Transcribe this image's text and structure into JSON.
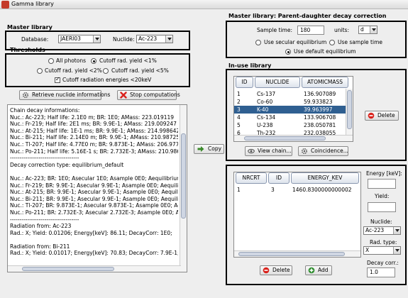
{
  "window": {
    "title": "Gamma library"
  },
  "master": {
    "title": "Master library",
    "database_label": "Database:",
    "database_value": "JAERI03",
    "nuclide_label": "Nuclide:",
    "nuclide_value": "Ac-223",
    "thresholds_title": "Thresholds",
    "radios": {
      "all_photons": "All photons",
      "cutoff1": "Cutoff rad. yield <1%",
      "cutoff2": "Cutoff rad. yield <2%",
      "cutoff5": "Cutoff rad. yield <5%"
    },
    "cutoff_checkbox": "Cutoff radiation energies <20keV",
    "retrieve_button": "Retrieve nuclide informations",
    "stop_button": "Stop computations",
    "copy_button": "Copy",
    "info_lines": [
      "Chain decay informations:",
      "Nuc.: Ac-223; Half life: 2.1E0 m; BR: 1E0; AMass: 223.019119",
      "Nuc.: Fr-219; Half life: 2E1 ms; BR: 9.9E-1; AMass: 219.009247",
      "Nuc.: At-215; Half life: 1E-1 ms; BR: 9.9E-1; AMass: 214.998642",
      "Nuc.: Bi-211; Half life: 2.14E0 m; BR: 9.9E-1; AMass: 210.987259",
      "Nuc.: Tl-207; Half life: 4.77E0 m; BR: 9.873E-1; AMass: 206.977402",
      "Nuc.: Po-211; Half life: 5.16E-1 s; BR: 2.732E-3; AMass: 210.986633",
      "------------------------------------",
      "Decay correction type: equilibrium_default",
      "",
      "Nuc.: Ac-223; BR: 1E0; Asecular 1E0; Asample 0E0; Aequilibrium 1E0; D",
      "Nuc.: Fr-219; BR: 9.9E-1; Asecular 9.9E-1; Asample 0E0; Aequilibrium 9.",
      "Nuc.: At-215; BR: 9.9E-1; Asecular 9.9E-1; Asample 0E0; Aequilibrium 9.",
      "Nuc.: Bi-211; BR: 9.9E-1; Asecular 9.9E-1; Asample 0E0; Aequilibrium 9.",
      "Nuc.: Tl-207; BR: 9.873E-1; Asecular 9.873E-1; Asample 0E0; Aequilibriu",
      "Nuc.: Po-211; BR: 2.732E-3; Asecular 2.732E-3; Asample 0E0; Aequilibriu",
      "------------------------------------",
      "Radiation from: Ac-223",
      "Rad.: X; Yield: 0.01206; Energy[keV]: 86.11; DecayCorr: 1E0;",
      "",
      "Radiation from: Bi-211",
      "Rad.: X; Yield: 0.01017; Energy[keV]: 70.83; DecayCorr: 7.9E-1;"
    ]
  },
  "decay": {
    "title": "Master library: Parent-daughter decay correction",
    "sample_time_label": "Sample time:",
    "sample_time_value": "180",
    "units_label": "units:",
    "units_value": "d",
    "use_secular": "Use secular equilibrium",
    "use_sample_time": "Use sample time",
    "use_default": "Use default equilibrium"
  },
  "inuse": {
    "title": "In-use library",
    "columns": [
      "ID",
      "NUCLIDE",
      "ATOMICMASS"
    ],
    "rows": [
      [
        "1",
        "Cs-137",
        "136.907089"
      ],
      [
        "2",
        "Co-60",
        "59.933823"
      ],
      [
        "3",
        "K-40",
        "39.963997"
      ],
      [
        "4",
        "Cs-134",
        "133.906708"
      ],
      [
        "5",
        "U-238",
        "238.050781"
      ],
      [
        "6",
        "Th-232",
        "232.038055"
      ]
    ],
    "delete_button": "Delete",
    "view_chain_button": "View chain...",
    "coincidence_button": "Coincidence..."
  },
  "rad": {
    "columns": [
      "NRCRT",
      "ID",
      "ENERGY_KEV"
    ],
    "rows": [
      [
        "1",
        "3",
        "1460.8300000000002"
      ]
    ],
    "delete_button": "Delete",
    "add_button": "Add",
    "energy_label": "Energy [keV]:",
    "energy_value": "",
    "yield_label": "Yield:",
    "yield_value": "",
    "nuclide_label": "Nuclide:",
    "nuclide_value": "Ac-223",
    "radtype_label": "Rad. type:",
    "radtype_value": "X",
    "decaycorr_label": "Decay corr.:",
    "decaycorr_value": "1.0"
  },
  "colors": {
    "selection": "#2f5f91",
    "stop_icon": "#d9221c",
    "delete_icon": "#d9221c",
    "add_icon": "#2c8c2c"
  }
}
